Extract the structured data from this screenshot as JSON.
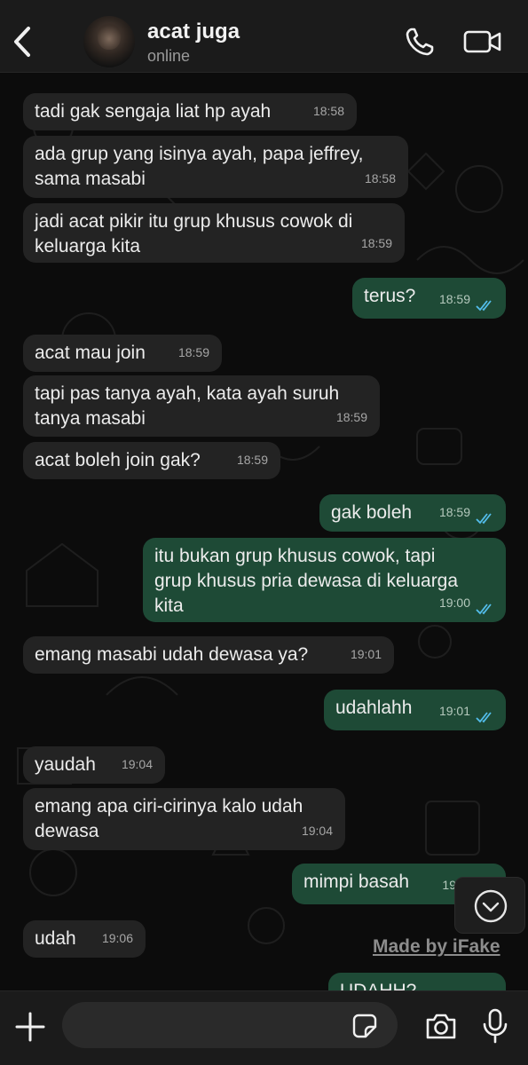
{
  "header": {
    "contact_name": "acat juga",
    "status": "online"
  },
  "icons": {
    "back": "chevron-left-icon",
    "call": "phone-icon",
    "video": "video-camera-icon",
    "scroll_down": "chevron-down-icon",
    "add": "plus-icon",
    "sticker": "sticker-icon",
    "camera": "camera-icon",
    "mic": "microphone-icon"
  },
  "colors": {
    "incoming_bubble": "#232323",
    "outgoing_bubble": "#1e4a36",
    "read_ticks": "#53bdeb"
  },
  "messages": [
    {
      "direction": "in",
      "text": "tadi gak sengaja liat hp ayah",
      "time": "18:58"
    },
    {
      "direction": "in",
      "text": "ada grup yang isinya ayah, papa jeffrey,\nsama masabi",
      "time": "18:58"
    },
    {
      "direction": "in",
      "text": "jadi acat pikir itu grup khusus cowok di\nkeluarga kita",
      "time": "18:59"
    },
    {
      "direction": "out",
      "text": "terus?",
      "time": "18:59",
      "status": "read"
    },
    {
      "direction": "in",
      "text": "acat mau join",
      "time": "18:59"
    },
    {
      "direction": "in",
      "text": "tapi pas tanya ayah, kata ayah suruh\ntanya masabi",
      "time": "18:59"
    },
    {
      "direction": "in",
      "text": "acat boleh join gak?",
      "time": "18:59"
    },
    {
      "direction": "out",
      "text": "gak boleh",
      "time": "18:59",
      "status": "read"
    },
    {
      "direction": "out",
      "text": "itu bukan grup khusus cowok, tapi\ngrup khusus pria dewasa di keluarga\nkita",
      "time": "19:00",
      "status": "read"
    },
    {
      "direction": "in",
      "text": "emang masabi udah dewasa ya?",
      "time": "19:01"
    },
    {
      "direction": "out",
      "text": "udahlahh",
      "time": "19:01",
      "status": "read"
    },
    {
      "direction": "in",
      "text": "yaudah",
      "time": "19:04"
    },
    {
      "direction": "in",
      "text": "emang apa ciri-cirinya kalo udah\ndewasa",
      "time": "19:04"
    },
    {
      "direction": "out",
      "text": "mimpi basah",
      "time": "19",
      "status": "read"
    },
    {
      "direction": "in",
      "text": "udah",
      "time": "19:06"
    },
    {
      "direction": "out",
      "text": "UDAHH?",
      "time": "",
      "status": ""
    }
  ],
  "watermark": "Made by iFake",
  "composer": {
    "value": "",
    "placeholder": ""
  }
}
